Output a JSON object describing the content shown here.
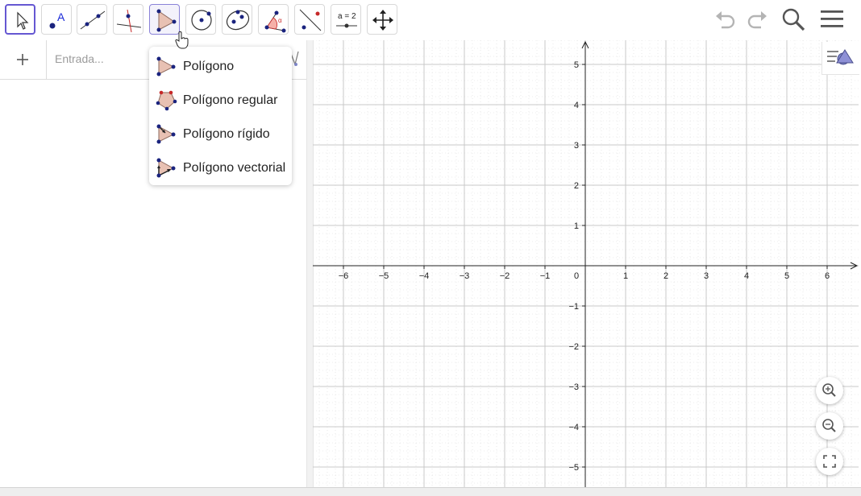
{
  "toolbar": {
    "tools": [
      {
        "name": "move-tool",
        "icon": "arrow-cursor-icon"
      },
      {
        "name": "point-tool",
        "icon": "point-icon",
        "label": "A"
      },
      {
        "name": "line-tool",
        "icon": "line-icon"
      },
      {
        "name": "perpendicular-tool",
        "icon": "perpendicular-icon"
      },
      {
        "name": "polygon-tool",
        "icon": "polygon-icon"
      },
      {
        "name": "circle-tool",
        "icon": "circle-center-point-icon"
      },
      {
        "name": "ellipse-tool",
        "icon": "ellipse-icon"
      },
      {
        "name": "angle-tool",
        "icon": "angle-icon",
        "label": "α"
      },
      {
        "name": "reflect-tool",
        "icon": "reflect-icon"
      },
      {
        "name": "slider-tool",
        "icon": "slider-icon",
        "label": "a = 2"
      },
      {
        "name": "move-view-tool",
        "icon": "move-arrows-icon"
      }
    ],
    "right": [
      "undo-icon",
      "redo-icon",
      "search-icon",
      "menu-icon"
    ]
  },
  "algebra": {
    "add_label": "+",
    "input_placeholder": "Entrada..."
  },
  "dropdown": {
    "items": [
      {
        "label": "Polígono",
        "icon": "polygon-icon"
      },
      {
        "label": "Polígono regular",
        "icon": "regular-polygon-icon"
      },
      {
        "label": "Polígono rígido",
        "icon": "rigid-polygon-icon"
      },
      {
        "label": "Polígono vectorial",
        "icon": "vector-polygon-icon"
      }
    ]
  },
  "graph": {
    "x_ticks": [
      "−6",
      "−5",
      "−4",
      "−3",
      "−2",
      "−1",
      "0",
      "1",
      "2",
      "3",
      "4",
      "5",
      "6"
    ],
    "y_ticks": [
      "5",
      "4",
      "3",
      "2",
      "1",
      "−1",
      "−2",
      "−3",
      "−4",
      "−5"
    ],
    "x_range": [
      -6.8,
      6.8
    ],
    "y_range": [
      -5.5,
      5.5
    ],
    "grid": true
  },
  "colors": {
    "accent": "#6557d2",
    "point": "#1a237e",
    "polygon_fill": "#e8c1b3",
    "polygon_stroke": "#8e6a5e",
    "red": "#c62828"
  }
}
